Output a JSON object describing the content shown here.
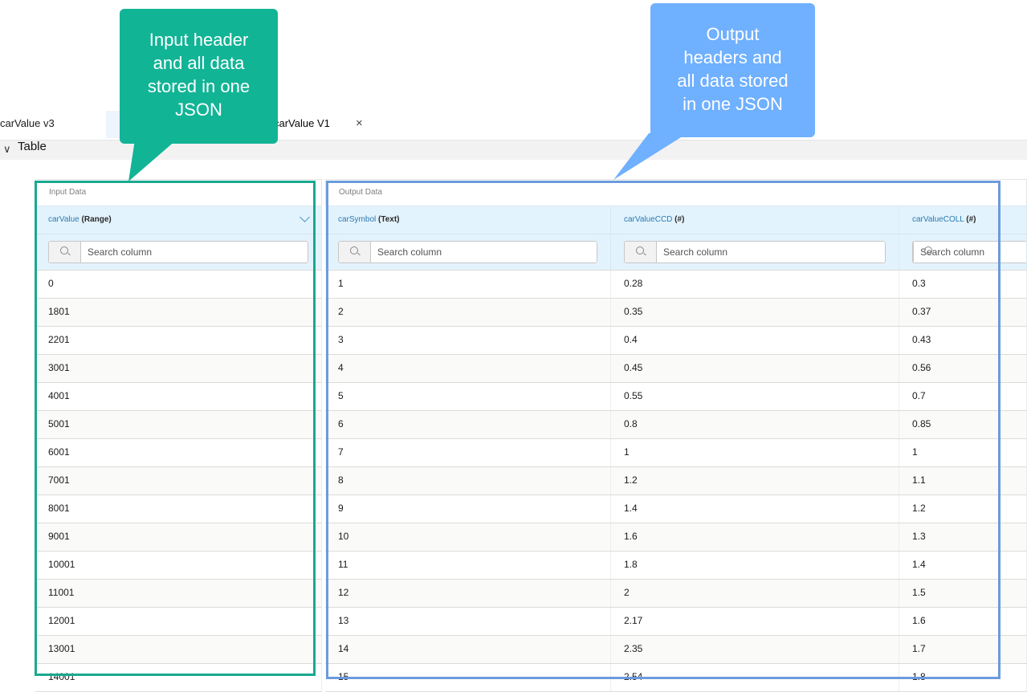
{
  "tabs": [
    {
      "label": "carValue v3"
    },
    {
      "label": "carValue V1",
      "close": "×"
    }
  ],
  "section": {
    "chevron": "∨",
    "title": "Table"
  },
  "input_grid": {
    "group_label": "Input Data",
    "columns": [
      {
        "name": "carValue",
        "type": "(Range)"
      }
    ],
    "search_placeholder": "Search column",
    "rows": [
      "0",
      "1801",
      "2201",
      "3001",
      "4001",
      "5001",
      "6001",
      "7001",
      "8001",
      "9001",
      "10001",
      "11001",
      "12001",
      "13001",
      "14001"
    ]
  },
  "output_grid": {
    "group_label": "Output Data",
    "columns": [
      {
        "name": "carSymbol",
        "type": "(Text)"
      },
      {
        "name": "carValueCCD",
        "type": "(#)"
      },
      {
        "name": "carValueCOLL",
        "type": "(#)"
      }
    ],
    "search_placeholder": "Search column",
    "rows": [
      [
        "1",
        "0.28",
        "0.3"
      ],
      [
        "2",
        "0.35",
        "0.37"
      ],
      [
        "3",
        "0.4",
        "0.43"
      ],
      [
        "4",
        "0.45",
        "0.56"
      ],
      [
        "5",
        "0.55",
        "0.7"
      ],
      [
        "6",
        "0.8",
        "0.85"
      ],
      [
        "7",
        "1",
        "1"
      ],
      [
        "8",
        "1.2",
        "1.1"
      ],
      [
        "9",
        "1.4",
        "1.2"
      ],
      [
        "10",
        "1.6",
        "1.3"
      ],
      [
        "11",
        "1.8",
        "1.4"
      ],
      [
        "12",
        "2",
        "1.5"
      ],
      [
        "13",
        "2.17",
        "1.6"
      ],
      [
        "14",
        "2.35",
        "1.7"
      ],
      [
        "15",
        "2.54",
        "1.8"
      ]
    ]
  },
  "callouts": {
    "input_text": "Input header\nand all data\nstored in one\nJSON",
    "output_text": "Output\nheaders and\nall data stored\nin one JSON",
    "input_color": "#12b496",
    "output_color": "#6fb0ff"
  }
}
